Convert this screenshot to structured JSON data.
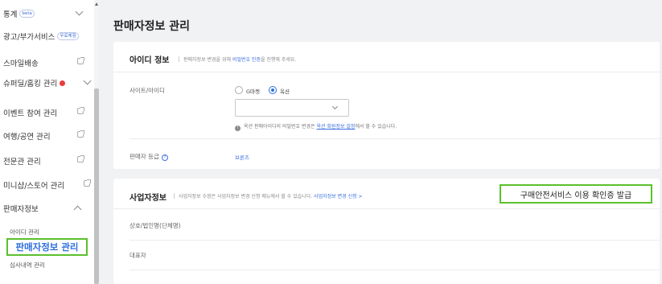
{
  "sidebar": {
    "items": [
      {
        "label": "통계",
        "badge": "beta",
        "chevron": "down"
      },
      {
        "label": "광고/부가서비스",
        "badge": "무료체험"
      },
      {
        "label": "스마일배송",
        "ext": true
      },
      {
        "label": "슈퍼딜/홈킹 관리",
        "dot": true,
        "chevron": "down"
      },
      {
        "label": "이벤트 참여 관리",
        "ext": true
      },
      {
        "label": "여행/공연 관리",
        "ext": true
      },
      {
        "label": "전문관 관리",
        "ext": true
      },
      {
        "label": "미니샵/스토어 관리",
        "ext": true
      },
      {
        "label": "판매자정보",
        "chevron": "up"
      }
    ],
    "sub_items": [
      "아이디 관리",
      "심사내역 관리"
    ],
    "active_item": "판매자정보 관리"
  },
  "main": {
    "title": "판매자정보 관리",
    "id_section": {
      "title": "아이디 정보",
      "desc_prefix": "판매자정보 변경을 위해",
      "desc_link": "비밀번호 인증",
      "desc_suffix": "을 진행해 주세요.",
      "site_label": "사이트/아이디",
      "radio_options": [
        "G마켓",
        "옥션"
      ],
      "radio_selected": "옥션",
      "select_value": "",
      "info_prefix": "옥션 판매아이디의 비밀번호 변경은",
      "info_link": "옥션 회원정보 설정",
      "info_suffix": "에서 할 수 있습니다.",
      "grade_label": "판매자 등급",
      "grade_value": "브론즈"
    },
    "business_section": {
      "title": "사업자정보",
      "desc": "사업자정보 수정은 사업자정보 변경 신청 메뉴에서 할 수 있습니다.",
      "desc_link": "사업자정보 변경 신청 >",
      "cert_button": "구매안전서비스 이용 확인증 발급",
      "fields": [
        "상호/법인명(단체명)",
        "대표자"
      ]
    }
  },
  "colors": {
    "accent": "#2f6fe0",
    "highlight": "#5bc02d",
    "badge_red": "#ea3a3a"
  }
}
